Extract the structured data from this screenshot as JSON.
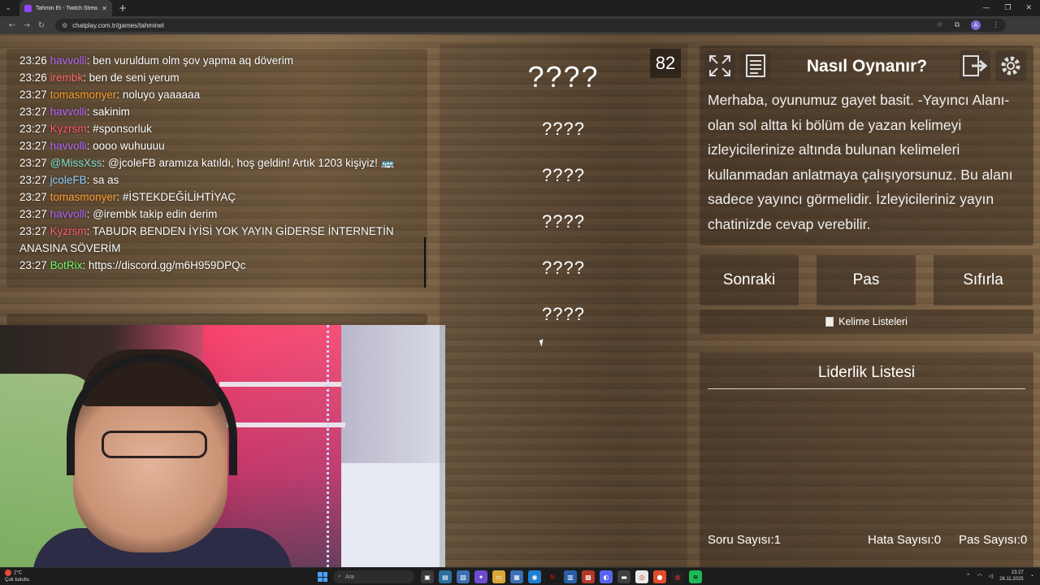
{
  "browser": {
    "tab_title": "Tahmin Et - Twitch Stream Game",
    "url": "chatplay.com.tr/games/tahminet",
    "profile_initial": "A"
  },
  "chat": {
    "lines": [
      {
        "time": "23:26",
        "user": "havvolli",
        "color": "#b468ff",
        "text": ": ben vuruldum olm şov yapma aq döverim"
      },
      {
        "time": "23:26",
        "user": "irembk",
        "color": "#ff6b6b",
        "text": ": ben de seni yerum"
      },
      {
        "time": "23:27",
        "user": "tomasmonyer",
        "color": "#ff9e2e",
        "text": ": noluyo yaaaaaa"
      },
      {
        "time": "23:27",
        "user": "havvolli",
        "color": "#b468ff",
        "text": ": sakinim"
      },
      {
        "time": "23:27",
        "user": "Kyzrsm",
        "color": "#ff5a7a",
        "text": ": #sponsorluk"
      },
      {
        "time": "23:27",
        "user": "havvolli",
        "color": "#b468ff",
        "text": ": oooo wuhuuuu"
      },
      {
        "time": "23:27",
        "user": "@MissXss",
        "color": "#7fe0d0",
        "text": ": @jcoleFB aramıza katıldı, hoş geldin! Artık 1203 kişiyiz! 🚌"
      },
      {
        "time": "23:27",
        "user": "jcoleFB",
        "color": "#8fd0ff",
        "text": ": sa as"
      },
      {
        "time": "23:27",
        "user": "tomasmonyer",
        "color": "#ff9e2e",
        "text": ": #İSTEKDEĞİLİHTİYAÇ"
      },
      {
        "time": "23:27",
        "user": "havvolli",
        "color": "#b468ff",
        "text": ": @irembk takip edin derim"
      },
      {
        "time": "23:27",
        "user": "Kyzrsm",
        "color": "#ff5a7a",
        "text": ": TABUDR BENDEN İYİSİ YOK YAYIN GİDERSE İNTERNETİN ANASINA SÖVERİM"
      },
      {
        "time": "23:27",
        "user": "BotRix",
        "color": "#6bff6b",
        "text": ": https://discord.gg/m6H959DPQc"
      }
    ]
  },
  "game": {
    "timer": "82",
    "main_word": "????",
    "forbidden_words": [
      "????",
      "????",
      "????",
      "????",
      "????"
    ]
  },
  "howto": {
    "title": "Nasıl Oynanır?",
    "text": "Merhaba, oyunumuz gayet basit. -Yayıncı Alanı- olan sol altta ki bölüm de yazan kelimeyi izleyicilerinize altında bulunan kelimeleri kullanmadan anlatmaya çalışıyorsunuz. Bu alanı sadece yayıncı görmelidir. İzleyicileriniz yayın chatinizde cevap verebilir."
  },
  "buttons": {
    "next": "Sonraki",
    "pass": "Pas",
    "reset": "Sıfırla",
    "word_lists": "Kelime Listeleri"
  },
  "leaderboard": {
    "title": "Liderlik Listesi"
  },
  "stats": {
    "questions_label": "Soru Sayısı:",
    "questions_value": "1",
    "errors_label": "Hata Sayısı:",
    "errors_value": "0",
    "passes_label": "Pas Sayısı:",
    "passes_value": "0"
  },
  "taskbar": {
    "weather_temp": "2°C",
    "weather_desc": "Çok bulutlu",
    "search_placeholder": "Ara",
    "time": "23:27",
    "date": "26.11.2025"
  }
}
